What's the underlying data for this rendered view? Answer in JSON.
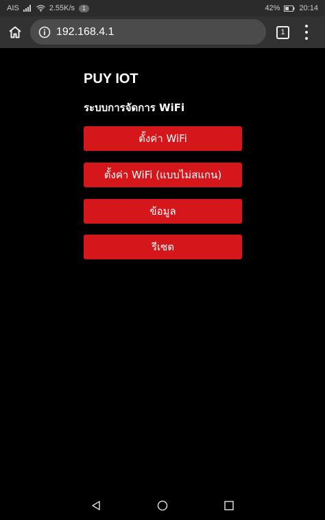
{
  "status_bar": {
    "carrier": "AIS",
    "speed": "2.55K/s",
    "notification_count": "1",
    "battery": "42%",
    "time": "20:14"
  },
  "browser": {
    "url": "192.168.4.1",
    "tab_count": "1"
  },
  "page": {
    "title": "PUY IOT",
    "subtitle": "ระบบการจัดการ WiFi",
    "buttons": [
      {
        "label": "ตั้งค่า WiFi"
      },
      {
        "label": "ตั้งค่า WiFi (แบบไม่สแกน)"
      },
      {
        "label": "ข้อมูล"
      },
      {
        "label": "รีเซต"
      }
    ]
  },
  "icons": {
    "home": "home-icon",
    "info": "info-icon",
    "tabs": "tab-switcher-icon",
    "menu": "more-vert-icon",
    "back": "back-triangle-icon",
    "home_nav": "home-circle-icon",
    "recents": "recents-square-icon"
  },
  "colors": {
    "background": "#000000",
    "button": "#d5171c",
    "toolbar": "#323232",
    "url_bar": "#4b4b4b",
    "status_bar": "#2b2b2b"
  }
}
